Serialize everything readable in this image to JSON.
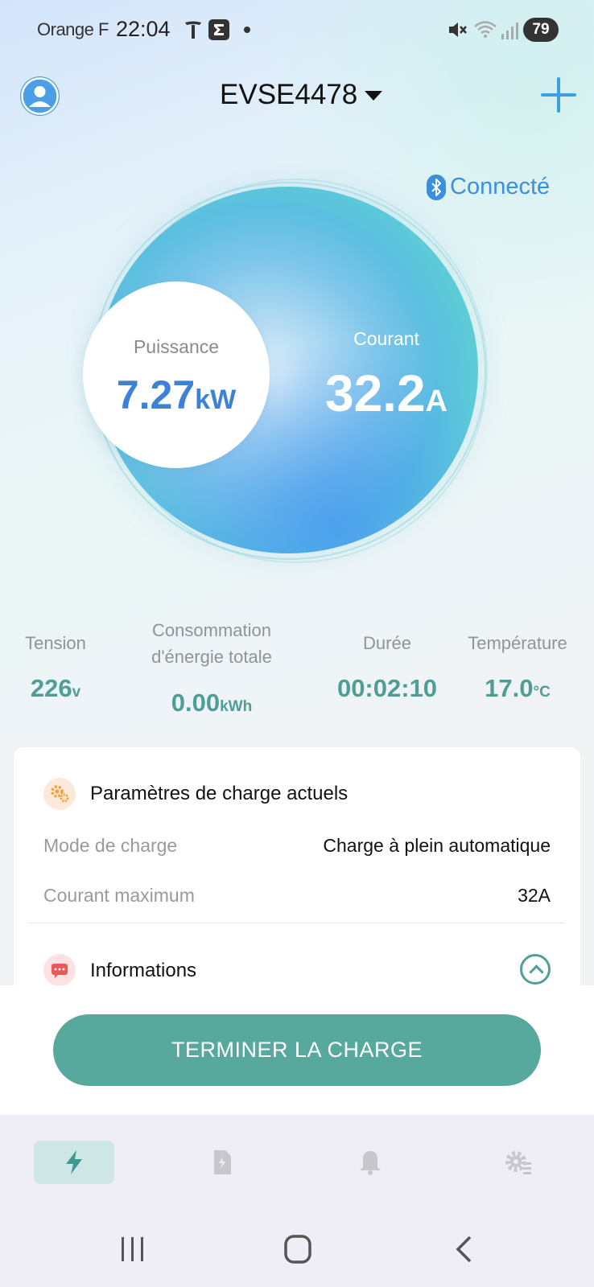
{
  "status_bar": {
    "carrier": "Orange F",
    "time": "22:04",
    "battery": "79",
    "icons": [
      "tesla-icon",
      "sigma-icon",
      "dot-icon",
      "mute-icon",
      "wifi-icon",
      "signal-icon"
    ]
  },
  "header": {
    "device_name": "EVSE4478",
    "icons": [
      "avatar-icon",
      "caret-down-icon",
      "plus-icon"
    ]
  },
  "connection": {
    "status": "Connecté",
    "icon": "bluetooth-icon"
  },
  "gauge": {
    "power": {
      "label": "Puissance",
      "value": "7.27",
      "unit": "kW"
    },
    "current": {
      "label": "Courant",
      "value": "32.2",
      "unit": "A"
    }
  },
  "stats": {
    "voltage": {
      "label": "Tension",
      "value": "226",
      "unit": "v"
    },
    "energy": {
      "label_line1": "Consommation",
      "label_line2": "d'énergie totale",
      "value": "0.00",
      "unit": "kWh"
    },
    "duration": {
      "label": "Durée",
      "value": "00:02:10"
    },
    "temperature": {
      "label": "Température",
      "value": "17.0",
      "unit": "°C"
    }
  },
  "params": {
    "title": "Paramètres de charge actuels",
    "mode_label": "Mode de charge",
    "mode_value": "Charge à plein automatique",
    "max_current_label": "Courant maximum",
    "max_current_value": "32A"
  },
  "info": {
    "title": "Informations"
  },
  "action": {
    "stop_label": "TERMINER LA CHARGE"
  },
  "bottom_nav": {
    "items": [
      "charging-icon",
      "report-icon",
      "notification-icon",
      "settings-icon"
    ],
    "active_index": 0
  },
  "colors": {
    "accent_teal": "#57a99d",
    "accent_blue": "#3d82d6",
    "stat_teal": "#4e9e96"
  }
}
